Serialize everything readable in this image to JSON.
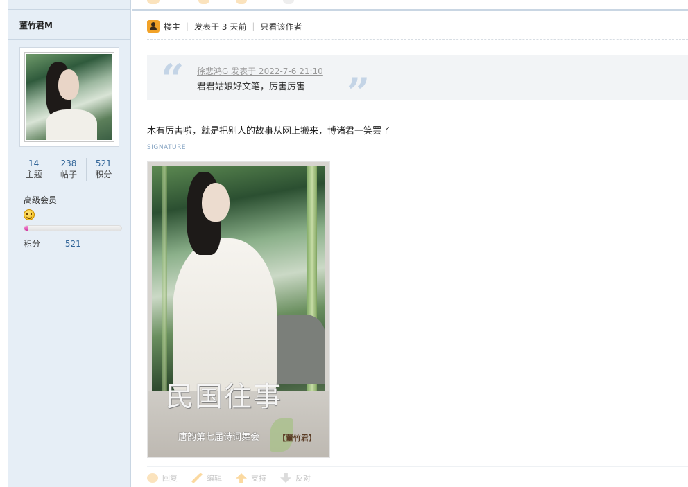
{
  "sidebar": {
    "username": "董竹君M",
    "stats": [
      {
        "num": "14",
        "label": "主题"
      },
      {
        "num": "238",
        "label": "帖子"
      },
      {
        "num": "521",
        "label": "积分"
      }
    ],
    "group": "高级会员",
    "progress_fraction": 0.04,
    "score_label": "积分",
    "score_value": "521"
  },
  "post": {
    "author_role": "楼主",
    "posted": "发表于 3 天前",
    "only_author": "只看该作者",
    "quote": {
      "meta": "徐悲鸿G 发表于 2022-7-6 21:10",
      "text": "君君姑娘好文笔，厉害厉害"
    },
    "reply_text": "木有厉害啦，就是把别人的故事从网上搬来，博诸君一笑罢了",
    "signature_label": "SIGNATURE",
    "signature_image": {
      "title": "民国往事",
      "subtitle": "唐韵第七届诗词舞会",
      "seal": "【董竹君】"
    }
  },
  "actions": [
    {
      "icon": "reply-icon",
      "label": "回复"
    },
    {
      "icon": "edit-icon",
      "label": "编辑"
    },
    {
      "icon": "thumbs-up-icon",
      "label": "支持"
    },
    {
      "icon": "thumbs-down-icon",
      "label": "反对"
    }
  ],
  "colors": {
    "sidebar_bg": "#e6eef6",
    "link_blue": "#336699",
    "quote_bg": "#f2f4f6",
    "badge_orange": "#f2a227"
  }
}
